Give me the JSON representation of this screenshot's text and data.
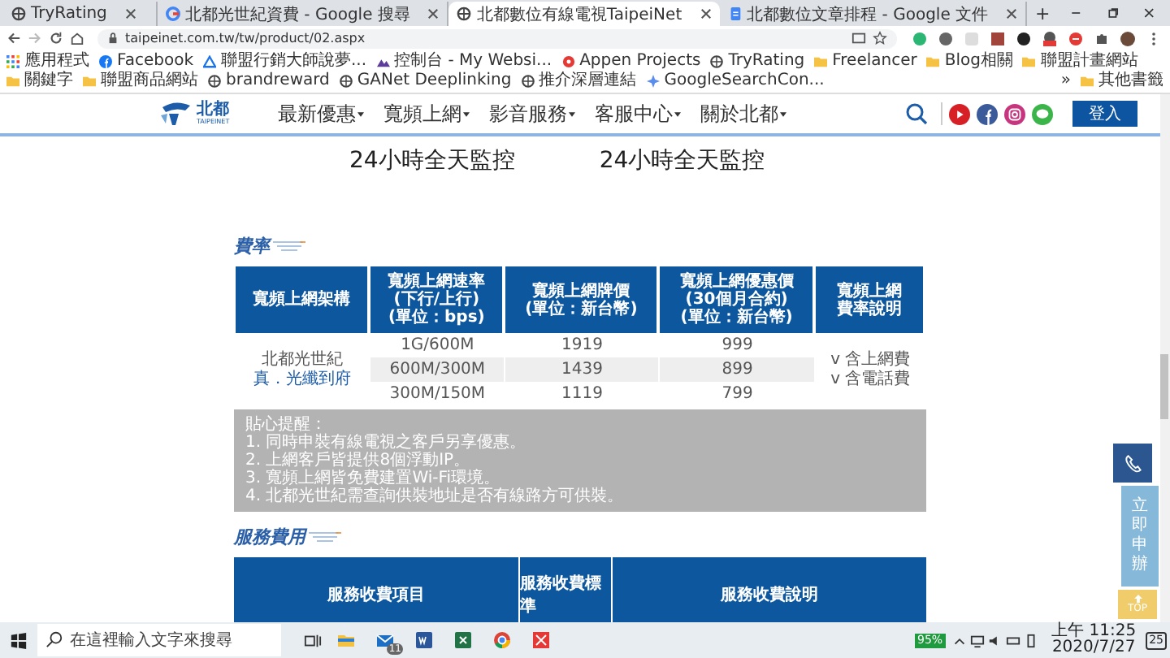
{
  "browser": {
    "tabs": [
      {
        "title": "TryRating",
        "kind": "site",
        "selected": false
      },
      {
        "title": "北都光世紀資費 - Google 搜尋",
        "kind": "google",
        "selected": false
      },
      {
        "title": "北都數位有線電視TaipeiNet",
        "kind": "site",
        "selected": true
      },
      {
        "title": "北都數位文章排程 - Google 文件",
        "kind": "docs",
        "selected": false
      }
    ],
    "new_tab": "+",
    "url": "taipeinet.com.tw/tw/product/02.aspx",
    "bookmarks": [
      {
        "label": "應用程式",
        "kind": "apps"
      },
      {
        "label": "Facebook",
        "kind": "facebook"
      },
      {
        "label": "聯盟行銷大師說夢...",
        "kind": "drive"
      },
      {
        "label": "控制台 - My Websi...",
        "kind": "mountain"
      },
      {
        "label": "Appen Projects",
        "kind": "appen"
      },
      {
        "label": "TryRating",
        "kind": "site"
      },
      {
        "label": "Freelancer",
        "kind": "folder"
      },
      {
        "label": "Blog相關",
        "kind": "folder"
      },
      {
        "label": "聯盟計畫網站",
        "kind": "folder"
      },
      {
        "label": "關鍵字",
        "kind": "folder"
      },
      {
        "label": "聯盟商品網站",
        "kind": "folder"
      },
      {
        "label": "brandreward",
        "kind": "site"
      },
      {
        "label": "GANet Deeplinking",
        "kind": "site"
      },
      {
        "label": "推介深層連結",
        "kind": "site"
      },
      {
        "label": "GoogleSearchCon...",
        "kind": "search"
      }
    ],
    "more_bookmarks": "»",
    "other_bookmarks": "其他書籤"
  },
  "site": {
    "logo_name": "北都",
    "logo_sub": "TAIPEINET",
    "nav": [
      "最新優惠",
      "寬頻上網",
      "影音服務",
      "客服中心",
      "關於北都"
    ],
    "login": "登入"
  },
  "features": [
    "24小時全天監控",
    "24小時全天監控"
  ],
  "rates": {
    "heading": "費率",
    "columns": [
      [
        "寬頻上網架構"
      ],
      [
        "寬頻上網速率",
        "(下行/上行)",
        "(單位：bps)"
      ],
      [
        "寬頻上網牌價",
        "(單位：新台幣)"
      ],
      [
        "寬頻上網優惠價",
        "(30個月合約)",
        "(單位：新台幣)"
      ],
      [
        "寬頻上網",
        "費率說明"
      ]
    ],
    "plan": "北都光世紀",
    "plan_note": "真．光纖到府",
    "rows": [
      {
        "speed": "1G/600M",
        "list_price": "1919",
        "promo_price": "999",
        "shaded": false
      },
      {
        "speed": "600M/300M",
        "list_price": "1439",
        "promo_price": "899",
        "shaded": true
      },
      {
        "speed": "300M/150M",
        "list_price": "1119",
        "promo_price": "799",
        "shaded": false
      }
    ],
    "includes": [
      "v 含上網費",
      "v 含電話費"
    ]
  },
  "tips": {
    "title": "貼心提醒：",
    "items": [
      "1. 同時申裝有線電視之客戶另享優惠。",
      "2. 上網客戶皆提供8個浮動IP。",
      "3. 寬頻上網皆免費建置Wi-Fi環境。",
      "4. 北都光世紀需查詢供裝地址是否有線路方可供裝。"
    ]
  },
  "service_fees": {
    "heading": "服務費用",
    "columns": [
      "服務收費項目",
      "服務收費標準",
      "服務收費說明"
    ]
  },
  "side": {
    "apply": "立即申辦",
    "top": "TOP"
  },
  "taskbar": {
    "search_placeholder": "在這裡輸入文字來搜尋",
    "mail_badge": "11",
    "battery": "95%",
    "time": "上午 11:25",
    "date": "2020/7/27",
    "notifications": "25"
  }
}
